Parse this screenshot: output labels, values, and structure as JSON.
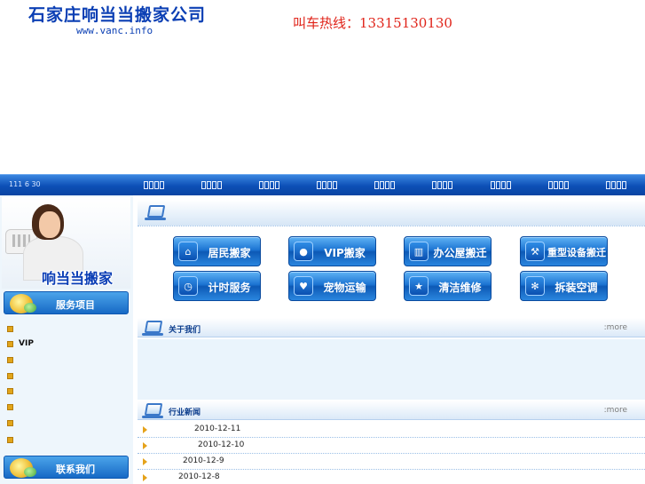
{
  "header": {
    "company_name": "石家庄响当当搬家公司",
    "url": "www.vanc.info",
    "hotline": "叫车热线：13315130130"
  },
  "nav": {
    "date": "111 6 30",
    "items": [
      "",
      "",
      "",
      "",
      "",
      "",
      "",
      "",
      ""
    ]
  },
  "sidebar": {
    "photo_caption": "响当当搬家",
    "services_heading": "服务项目",
    "contact_heading": "联系我们",
    "menu_items": [
      "",
      "VIP",
      "",
      "",
      "",
      "",
      "",
      ""
    ]
  },
  "services": {
    "buttons": [
      {
        "label": "居民搬家",
        "icon": "home-icon"
      },
      {
        "label": "VIP搬家",
        "icon": "user-icon"
      },
      {
        "label": "办公屋搬迁",
        "icon": "office-icon"
      },
      {
        "label": "重型设备搬迁",
        "icon": "wrench-icon"
      },
      {
        "label": "计时服务",
        "icon": "clock-icon"
      },
      {
        "label": "宠物运输",
        "icon": "heart-icon"
      },
      {
        "label": "清洁维修",
        "icon": "star-icon"
      },
      {
        "label": "拆装空调",
        "icon": "snowflake-icon"
      }
    ]
  },
  "about": {
    "title": "关于我们",
    "more": ":more"
  },
  "news": {
    "title": "行业新闻",
    "more": ":more",
    "items": [
      {
        "date": "2010-12-11"
      },
      {
        "date": "2010-12-10"
      },
      {
        "date": "2010-12-9"
      },
      {
        "date": "2010-12-8"
      }
    ]
  },
  "colors": {
    "brand_blue": "#0b3fb4",
    "hotline_red": "#e0241a",
    "nav_blue": "#0c4fb6",
    "bullet_orange": "#e1a51a"
  }
}
